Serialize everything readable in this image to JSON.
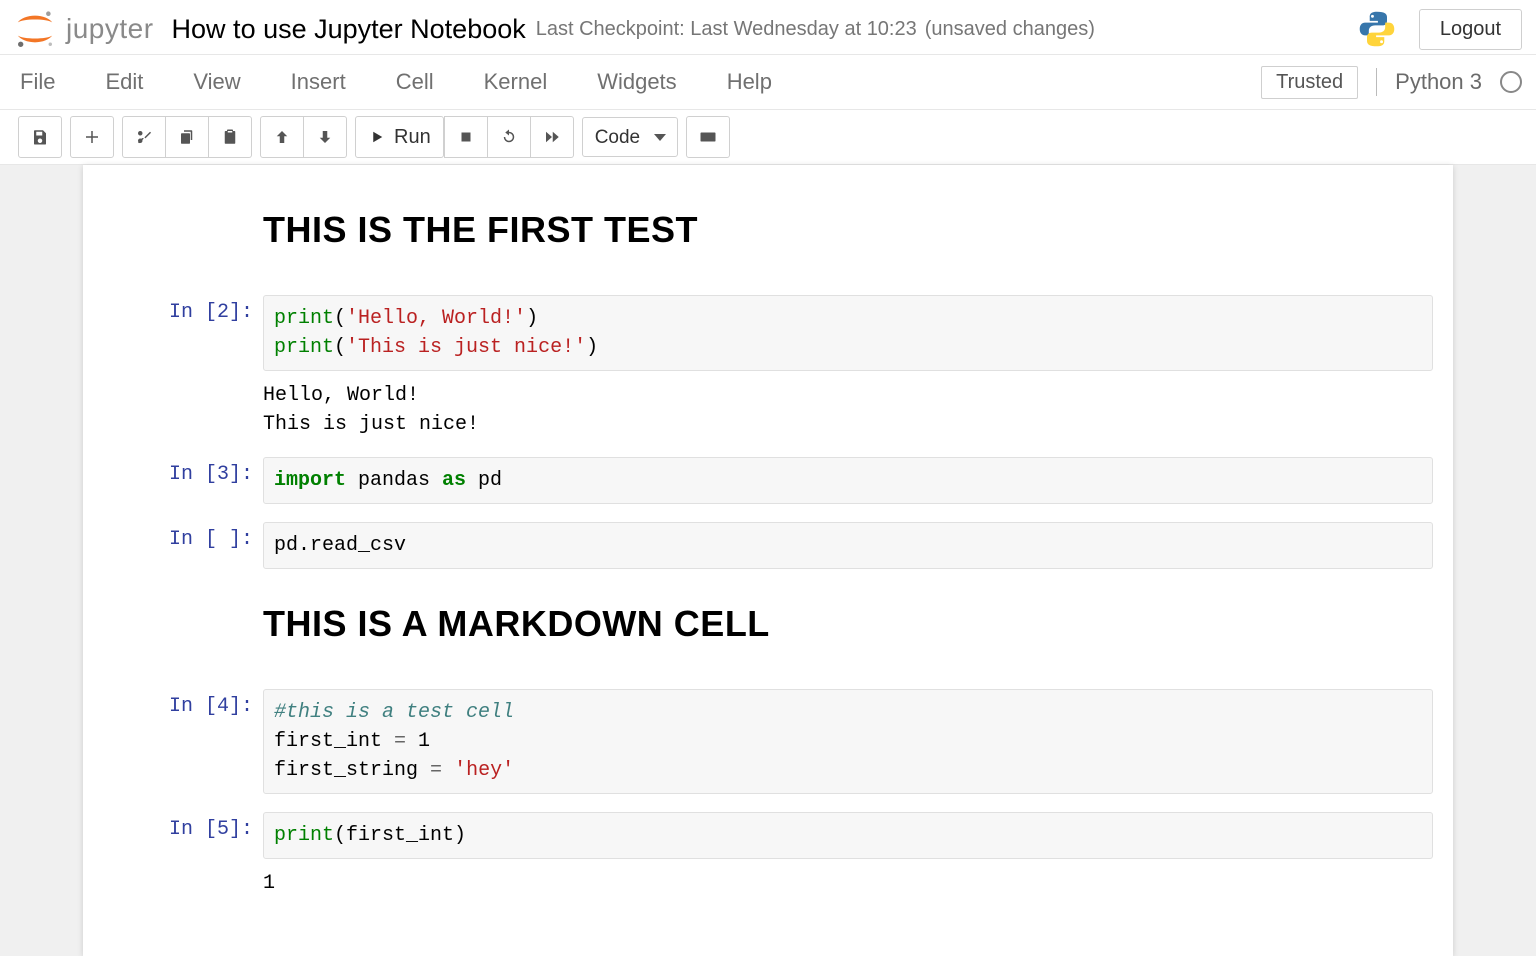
{
  "header": {
    "logo_text": "jupyter",
    "notebook_title": "How to use Jupyter Notebook",
    "checkpoint_text": "Last Checkpoint: Last Wednesday at 10:23",
    "unsaved_text": "(unsaved changes)",
    "logout_label": "Logout"
  },
  "menubar": {
    "items": [
      "File",
      "Edit",
      "View",
      "Insert",
      "Cell",
      "Kernel",
      "Widgets",
      "Help"
    ],
    "trusted_label": "Trusted",
    "kernel_name": "Python 3"
  },
  "toolbar": {
    "run_label": "Run",
    "cell_type_selected": "Code"
  },
  "cells": [
    {
      "type": "markdown",
      "rendered_h1": "THIS IS THE FIRST TEST"
    },
    {
      "type": "code",
      "prompt": "In [2]:",
      "tokens": [
        {
          "t": "fn",
          "v": "print"
        },
        {
          "t": "",
          "v": "("
        },
        {
          "t": "str",
          "v": "'Hello, World!'"
        },
        {
          "t": "",
          "v": ")"
        },
        {
          "t": "nl",
          "v": "\n"
        },
        {
          "t": "fn",
          "v": "print"
        },
        {
          "t": "",
          "v": "("
        },
        {
          "t": "str",
          "v": "'This is just nice!'"
        },
        {
          "t": "",
          "v": ")"
        }
      ],
      "output": "Hello, World!\nThis is just nice!"
    },
    {
      "type": "code",
      "prompt": "In [3]:",
      "tokens": [
        {
          "t": "kw",
          "v": "import"
        },
        {
          "t": "",
          "v": " pandas "
        },
        {
          "t": "kw",
          "v": "as"
        },
        {
          "t": "",
          "v": " pd"
        }
      ]
    },
    {
      "type": "code",
      "prompt": "In [ ]:",
      "tokens": [
        {
          "t": "",
          "v": "pd.read_csv"
        }
      ]
    },
    {
      "type": "markdown",
      "rendered_h1": "THIS IS A MARKDOWN CELL"
    },
    {
      "type": "code",
      "prompt": "In [4]:",
      "tokens": [
        {
          "t": "cmt",
          "v": "#this is a test cell"
        },
        {
          "t": "nl",
          "v": "\n"
        },
        {
          "t": "",
          "v": "first_int "
        },
        {
          "t": "op",
          "v": "="
        },
        {
          "t": "",
          "v": " 1"
        },
        {
          "t": "nl",
          "v": "\n"
        },
        {
          "t": "",
          "v": "first_string "
        },
        {
          "t": "op",
          "v": "="
        },
        {
          "t": "",
          "v": " "
        },
        {
          "t": "str",
          "v": "'hey'"
        }
      ]
    },
    {
      "type": "code",
      "prompt": "In [5]:",
      "tokens": [
        {
          "t": "fn",
          "v": "print"
        },
        {
          "t": "",
          "v": "(first_int)"
        }
      ],
      "output": "1"
    }
  ]
}
